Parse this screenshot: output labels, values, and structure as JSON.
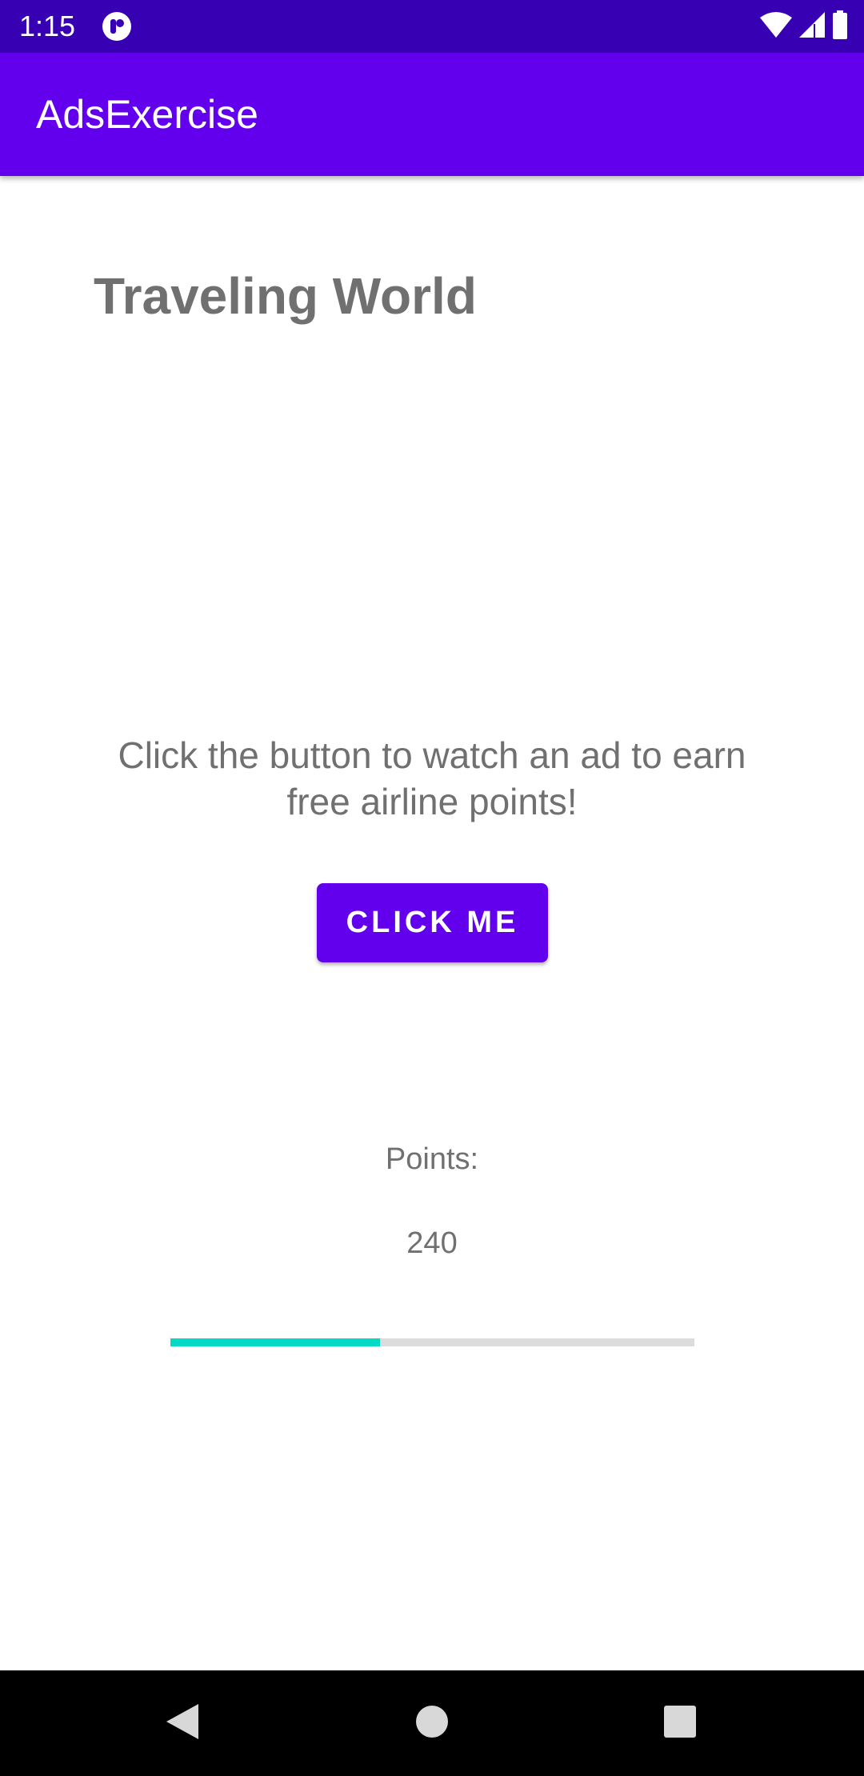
{
  "status_bar": {
    "time": "1:15",
    "icons": [
      "app-notification-icon",
      "wifi-icon",
      "cellular-signal-icon",
      "battery-icon"
    ]
  },
  "app_bar": {
    "title": "AdsExercise"
  },
  "main": {
    "heading": "Traveling World",
    "instructions": "Click the button to watch an ad to earn free airline points!",
    "button_label": "Click Me",
    "points_label": "Points:",
    "points_value": "240",
    "progress_fraction": 0.4
  },
  "nav_bar": {
    "icons": [
      "back-icon",
      "home-icon",
      "recents-icon"
    ]
  },
  "colors": {
    "status_bar": "#3700b3",
    "primary": "#6200ee",
    "accent": "#03dac5",
    "text_gray": "#707070"
  }
}
